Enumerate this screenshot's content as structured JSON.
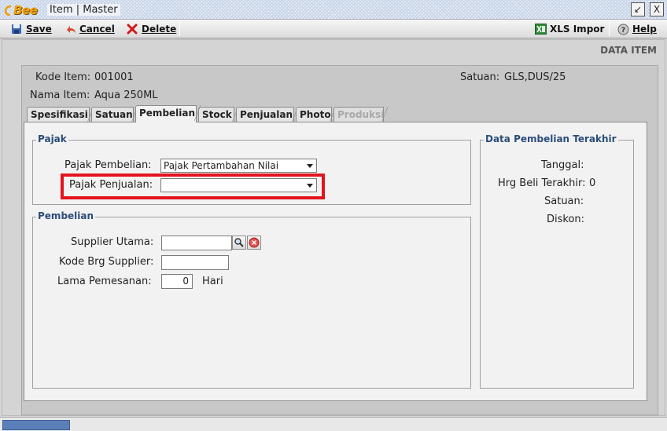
{
  "window": {
    "logo_text": "Bee",
    "title": "Item | Master",
    "restore_glyph": "↙",
    "close_glyph": "X"
  },
  "toolbar": {
    "save_label": "Save",
    "cancel_label": "Cancel",
    "delete_label": "Delete",
    "xls_label": "XLS Impor",
    "help_label": "Help"
  },
  "header": {
    "section_title": "DATA ITEM",
    "kode_item_label": "Kode Item:",
    "kode_item_value": "001001",
    "nama_item_label": "Nama Item:",
    "nama_item_value": "Aqua 250ML",
    "satuan_label": "Satuan:",
    "satuan_value": "GLS,DUS/25"
  },
  "tabs": [
    {
      "label": "Spesifikasi",
      "active": false,
      "disabled": false
    },
    {
      "label": "Satuan",
      "active": false,
      "disabled": false
    },
    {
      "label": "Pembelian",
      "active": true,
      "disabled": false
    },
    {
      "label": "Stock",
      "active": false,
      "disabled": false
    },
    {
      "label": "Penjualan",
      "active": false,
      "disabled": false
    },
    {
      "label": "Photo",
      "active": false,
      "disabled": false
    },
    {
      "label": "Produksi",
      "active": false,
      "disabled": true
    }
  ],
  "pajak": {
    "legend": "Pajak",
    "pembelian_label": "Pajak Pembelian:",
    "pembelian_value": "Pajak Pertambahan Nilai",
    "penjualan_label": "Pajak Penjualan:",
    "penjualan_value": ""
  },
  "pembelian": {
    "legend": "Pembelian",
    "supplier_label": "Supplier Utama:",
    "supplier_value": "",
    "kode_brg_label": "Kode Brg Supplier:",
    "kode_brg_value": "",
    "lama_label": "Lama Pemesanan:",
    "lama_value": "0",
    "lama_unit": "Hari"
  },
  "terakhir": {
    "legend": "Data Pembelian Terakhir",
    "tanggal_label": "Tanggal:",
    "tanggal_value": "",
    "harga_label": "Hrg Beli Terakhir:",
    "harga_value": "0",
    "satuan_label": "Satuan:",
    "satuan_value": "",
    "diskon_label": "Diskon:",
    "diskon_value": ""
  },
  "colors": {
    "highlight": "#e3141d",
    "legend_text": "#2b4d7a",
    "accent_logo": "#f2a000"
  },
  "icons": [
    "save-icon",
    "cancel-icon",
    "delete-icon",
    "xls-icon",
    "help-icon",
    "search-icon",
    "clear-icon"
  ]
}
